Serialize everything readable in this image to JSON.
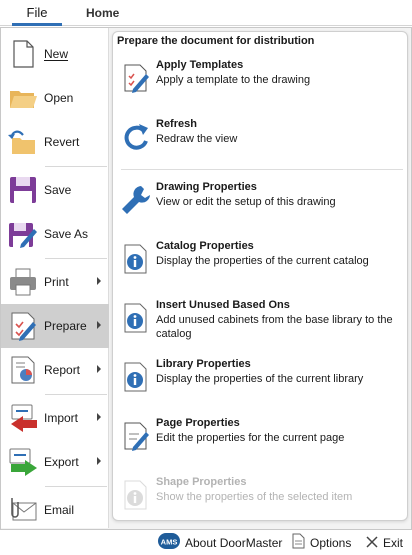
{
  "ribbon": {
    "tabs": [
      "File",
      "Home"
    ]
  },
  "menu": {
    "items": [
      {
        "key": "new",
        "label": "New",
        "icon": "new-document-icon",
        "submenu": false
      },
      {
        "key": "open",
        "label": "Open",
        "icon": "open-folder-icon",
        "submenu": false
      },
      {
        "key": "revert",
        "label": "Revert",
        "icon": "revert-icon",
        "submenu": false
      },
      {
        "key": "save",
        "label": "Save",
        "icon": "save-icon",
        "submenu": false
      },
      {
        "key": "save-as",
        "label": "Save As",
        "icon": "save-as-icon",
        "submenu": false
      },
      {
        "key": "print",
        "label": "Print",
        "icon": "printer-icon",
        "submenu": true
      },
      {
        "key": "prepare",
        "label": "Prepare",
        "icon": "prepare-icon",
        "submenu": true,
        "selected": true
      },
      {
        "key": "report",
        "label": "Report",
        "icon": "report-icon",
        "submenu": true
      },
      {
        "key": "import",
        "label": "Import",
        "icon": "import-icon",
        "submenu": true
      },
      {
        "key": "export",
        "label": "Export",
        "icon": "export-icon",
        "submenu": true
      },
      {
        "key": "email",
        "label": "Email",
        "icon": "email-icon",
        "submenu": false
      }
    ]
  },
  "panel": {
    "header": "Prepare the document for distribution",
    "items": [
      {
        "key": "apply-templates",
        "title": "Apply Templates",
        "desc": "Apply a template to the drawing",
        "icon": "template-edit-icon",
        "enabled": true
      },
      {
        "key": "refresh",
        "title": "Refresh",
        "desc": "Redraw the view",
        "icon": "refresh-icon",
        "enabled": true
      },
      {
        "key": "drawing-properties",
        "title": "Drawing Properties",
        "desc": "View or edit the setup of this drawing",
        "icon": "wrench-icon",
        "enabled": true
      },
      {
        "key": "catalog-properties",
        "title": "Catalog Properties",
        "desc": "Display the properties of the current catalog",
        "icon": "info-document-icon",
        "enabled": true
      },
      {
        "key": "insert-unused",
        "title": "Insert Unused Based Ons",
        "desc": "Add unused cabinets from the base library to the catalog",
        "icon": "info-document-icon",
        "enabled": true
      },
      {
        "key": "library-properties",
        "title": "Library Properties",
        "desc": "Display the properties of the current library",
        "icon": "info-document-icon",
        "enabled": true
      },
      {
        "key": "page-properties",
        "title": "Page Properties",
        "desc": "Edit the properties for the current page",
        "icon": "page-edit-icon",
        "enabled": true
      },
      {
        "key": "shape-properties",
        "title": "Shape Properties",
        "desc": "Show the properties of the selected item",
        "icon": "info-document-icon",
        "enabled": false
      }
    ]
  },
  "statusbar": {
    "about": "About DoorMaster",
    "about_badge": "AMS",
    "options": "Options",
    "exit": "Exit"
  },
  "colors": {
    "accent": "#2f6fb5",
    "selected_bg": "#cfcfcf",
    "disabled_text": "#b3b3b3",
    "folder": "#f0c36d",
    "save_purple": "#7d3c98",
    "report_red": "#d9534f",
    "import_red": "#c9302c",
    "export_green": "#3aa63a"
  }
}
